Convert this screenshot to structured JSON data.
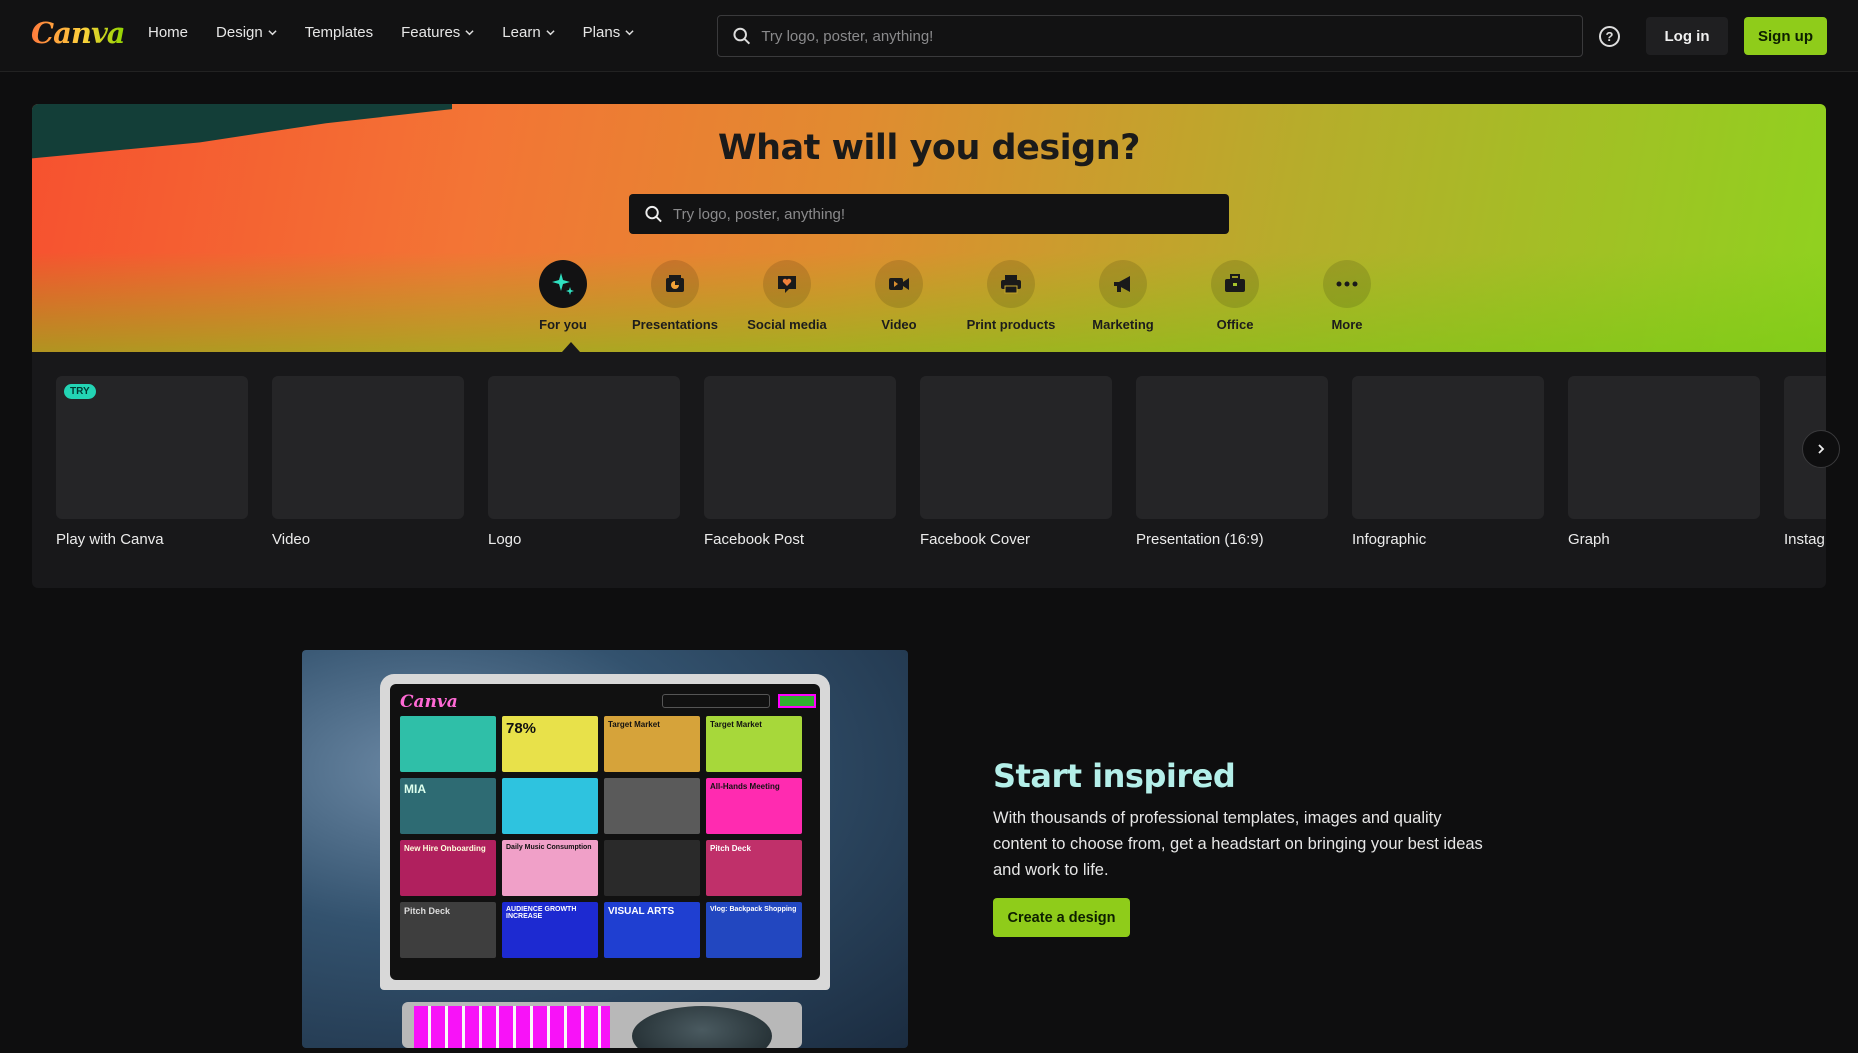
{
  "brand": {
    "logo_text": "Canva",
    "accent": "#8fcc1a"
  },
  "nav": {
    "items": [
      {
        "label": "Home",
        "has_dropdown": false
      },
      {
        "label": "Design",
        "has_dropdown": true
      },
      {
        "label": "Templates",
        "has_dropdown": false
      },
      {
        "label": "Features",
        "has_dropdown": true
      },
      {
        "label": "Learn",
        "has_dropdown": true
      },
      {
        "label": "Plans",
        "has_dropdown": true
      }
    ]
  },
  "top_search": {
    "placeholder": "Try logo, poster, anything!",
    "value": ""
  },
  "auth": {
    "login_label": "Log in",
    "signup_label": "Sign up"
  },
  "hero": {
    "title": "What will you design?",
    "search_placeholder": "Try logo, poster, anything!",
    "categories": [
      {
        "label": "For you",
        "icon": "sparkle-icon",
        "active": true
      },
      {
        "label": "Presentations",
        "icon": "presentation-icon",
        "active": false
      },
      {
        "label": "Social media",
        "icon": "heart-chat-icon",
        "active": false
      },
      {
        "label": "Video",
        "icon": "video-camera-icon",
        "active": false
      },
      {
        "label": "Print products",
        "icon": "printer-icon",
        "active": false
      },
      {
        "label": "Marketing",
        "icon": "megaphone-icon",
        "active": false
      },
      {
        "label": "Office",
        "icon": "briefcase-icon",
        "active": false
      },
      {
        "label": "More",
        "icon": "more-dots-icon",
        "active": false
      }
    ]
  },
  "design_cards": [
    {
      "label": "Play with Canva",
      "badge": "TRY"
    },
    {
      "label": "Video"
    },
    {
      "label": "Logo"
    },
    {
      "label": "Facebook Post"
    },
    {
      "label": "Facebook Cover"
    },
    {
      "label": "Presentation (16:9)"
    },
    {
      "label": "Infographic"
    },
    {
      "label": "Graph"
    },
    {
      "label": "Instag"
    }
  ],
  "promo": {
    "title": "Start inspired",
    "body": "With thousands of professional templates, images and quality content to choose from, get a headstart on bringing your best ideas and work to life.",
    "cta_label": "Create a design",
    "screen_logo": "Canva",
    "tiles": [
      "",
      "78%",
      "Target Market",
      "Target Market",
      "MIA",
      "",
      "",
      "All-Hands Meeting",
      "New Hire Onboarding",
      "Daily Music Consumption",
      "",
      "Pitch Deck",
      "Pitch Deck",
      "AUDIENCE GROWTH INCREASE",
      "VISUAL ARTS",
      "Vlog: Backpack Shopping"
    ]
  }
}
